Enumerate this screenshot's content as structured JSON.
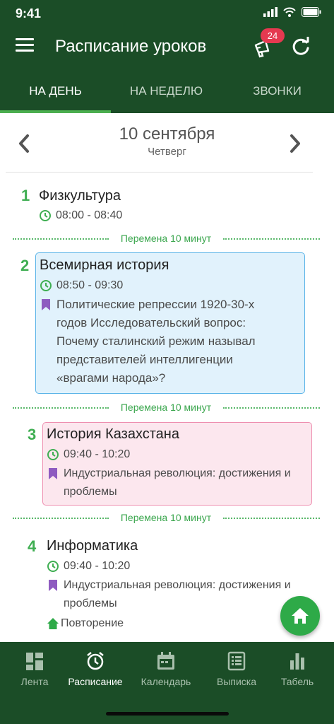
{
  "status": {
    "time": "9:41"
  },
  "app": {
    "title": "Расписание уроков",
    "badge": "24"
  },
  "tabs": [
    {
      "label": "НА ДЕНЬ"
    },
    {
      "label": "НА НЕДЕЛЮ"
    },
    {
      "label": "ЗВОНКИ"
    }
  ],
  "date": {
    "main": "10 сентября",
    "weekday": "Четверг"
  },
  "lessons": [
    {
      "num": "1",
      "subject": "Физкультура",
      "time": "08:00 - 08:40"
    },
    {
      "num": "2",
      "subject": "Всемирная история",
      "time": "08:50 - 09:30",
      "topic": "Политические репрессии 1920-30-х годов Исследовательский вопрос: Почему сталинский режим называл представителей интеллигенции «врагами народа»?"
    },
    {
      "num": "3",
      "subject": "История Казахстана",
      "time": "09:40 - 10:20",
      "topic": "Индустриальная революция: достижения и проблемы"
    },
    {
      "num": "4",
      "subject": "Информатика",
      "time": "09:40 - 10:20",
      "topic": "Индустриальная революция: достижения и проблемы",
      "homework": "Повторение"
    }
  ],
  "breaks": [
    {
      "label": "Перемена 10 минут"
    },
    {
      "label": "Перемена 10 минут"
    },
    {
      "label": "Перемена 10 минут"
    }
  ],
  "bottom_nav": [
    {
      "label": "Лента"
    },
    {
      "label": "Расписание"
    },
    {
      "label": "Календарь"
    },
    {
      "label": "Выписка"
    },
    {
      "label": "Табель"
    }
  ],
  "colors": {
    "primary": "#1b4d27",
    "accent": "#3fae52",
    "badge": "#e53950",
    "card_blue": "#e1f2fc",
    "card_pink": "#fce7ee",
    "topic_icon": "#8e5bc0"
  }
}
